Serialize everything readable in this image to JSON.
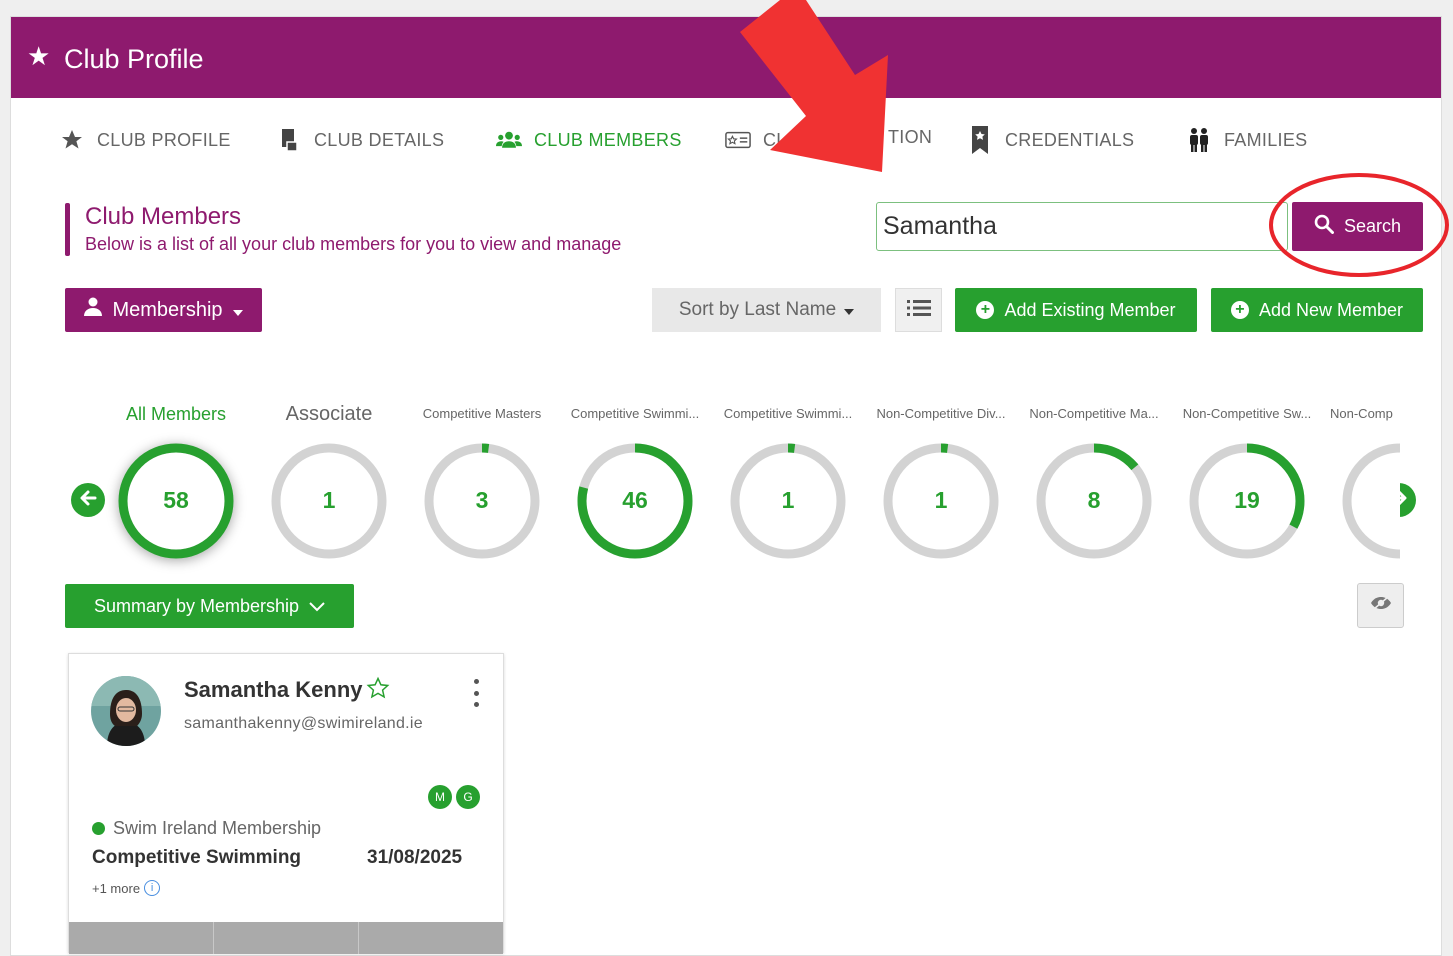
{
  "header": {
    "title": "Club Profile",
    "icon": "star-icon"
  },
  "tabs": [
    {
      "label": "CLUB PROFILE",
      "icon": "star-icon",
      "active": false
    },
    {
      "label": "CLUB DETAILS",
      "icon": "document-icon",
      "active": false
    },
    {
      "label": "CLUB MEMBERS",
      "icon": "users-icon",
      "active": true
    },
    {
      "label": "CL",
      "icon": "id-card-icon",
      "active": false
    },
    {
      "label": "TION",
      "icon": "",
      "active": false
    },
    {
      "label": "CREDENTIALS",
      "icon": "bookmark-icon",
      "active": false
    },
    {
      "label": "FAMILIES",
      "icon": "family-icon",
      "active": false
    }
  ],
  "section": {
    "title": "Club Members",
    "subtitle": "Below is a list of all your club members for you to view and manage"
  },
  "search": {
    "value": "Samantha",
    "button_label": "Search"
  },
  "toolbar": {
    "membership_label": "Membership",
    "sort_label": "Sort by Last Name",
    "add_existing_label": "Add Existing Member",
    "add_new_label": "Add New Member"
  },
  "categories": [
    {
      "label": "All Members",
      "count": "58",
      "fraction": 1.0
    },
    {
      "label": "Associate",
      "count": "1",
      "fraction": 0.0
    },
    {
      "label": "Competitive Masters",
      "count": "3",
      "fraction": 0.02
    },
    {
      "label": "Competitive Swimmi...",
      "count": "46",
      "fraction": 0.79
    },
    {
      "label": "Competitive Swimmi...",
      "count": "1",
      "fraction": 0.02
    },
    {
      "label": "Non-Competitive Div...",
      "count": "1",
      "fraction": 0.02
    },
    {
      "label": "Non-Competitive Ma...",
      "count": "8",
      "fraction": 0.14
    },
    {
      "label": "Non-Competitive Sw...",
      "count": "19",
      "fraction": 0.33
    },
    {
      "label": "Non-Comp",
      "count": "",
      "fraction": 0.0
    }
  ],
  "summary_label": "Summary by Membership",
  "member": {
    "name": "Samantha Kenny",
    "email": "samanthakenny@swimireland.ie",
    "badges": [
      "M",
      "G"
    ],
    "status": "Swim Ireland Membership",
    "type": "Competitive Swimming",
    "expiry": "31/08/2025",
    "more": "+1 more"
  },
  "colors": {
    "brand": "#8e1a6e",
    "accent": "#27a02f",
    "annotation": "#f03232"
  }
}
